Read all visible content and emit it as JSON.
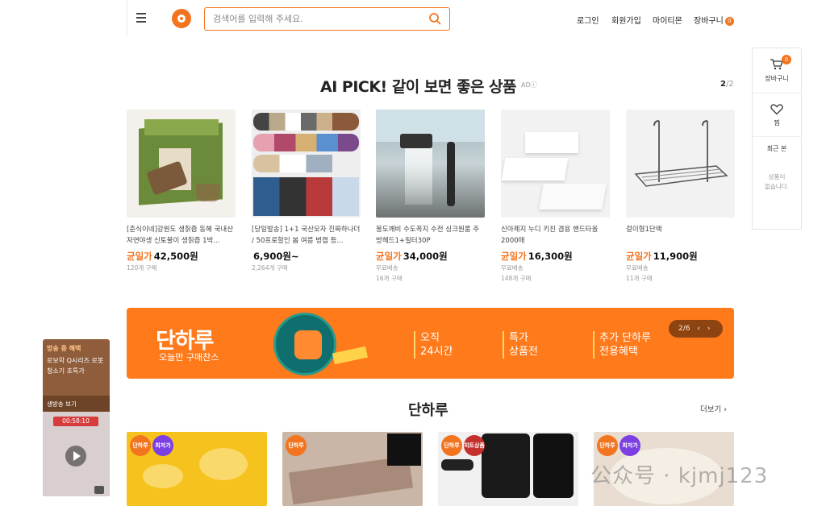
{
  "header": {
    "search_placeholder": "검색어를 입력해 주세요.",
    "nav": {
      "login": "로그인",
      "signup": "회원가입",
      "mytemon": "마이티몬",
      "cart": "장바구니",
      "cart_count": "0"
    }
  },
  "side": {
    "cart_label": "장바구니",
    "cart_count": "0",
    "wish_label": "찜",
    "recent_label": "최근 본",
    "empty_text": "상품이\n없습니다."
  },
  "ai_pick": {
    "title": "AI PICK! 같이 보면 좋은 상품",
    "ad": "ADⓘ",
    "page_current": "2",
    "page_total": "/2",
    "products": [
      {
        "name": "[춘식이네]강원도 생칡즙 동해 국내산 자연야생 신토불이 생칡즙 1박...",
        "price_tag": "균일가",
        "price": "42,500원",
        "shipping": "",
        "sold": "120개 구매"
      },
      {
        "name": "[당일발송] 1+1 국산모자 진짜하나더 / 50프로할인 봄 여름 벙캡 등...",
        "price_tag": "",
        "price": "6,900원~",
        "shipping": "",
        "sold": "2,264개 구매"
      },
      {
        "name": "볼도깨비 수도꼭지 수전 싱크원룸 주방헤드1+필터30P",
        "price_tag": "균일가",
        "price": "34,000원",
        "shipping": "무료배송",
        "sold": "16개 구매"
      },
      {
        "name": "신아제지 누디 키친 겸용 핸드타올 2000매",
        "price_tag": "균일가",
        "price": "16,300원",
        "shipping": "무료배송",
        "sold": "148개 구매"
      },
      {
        "name": "걸이형1단랙",
        "price_tag": "균일가",
        "price": "11,900원",
        "shipping": "무료배송",
        "sold": "11개 구매"
      }
    ]
  },
  "banner": {
    "title": "단하루",
    "subtitle": "오늘만 구매찬스",
    "features": [
      {
        "l1": "오직",
        "l2": "24시간"
      },
      {
        "l1": "특가",
        "l2": "상품전"
      },
      {
        "l1": "추가 단하루",
        "l2": "전용혜택"
      }
    ],
    "pager": "2/6"
  },
  "dahalu": {
    "title": "단하루",
    "more": "더보기",
    "chip": "단하루",
    "chip_purple": "최저가",
    "chip_red": "히트상품"
  },
  "live": {
    "label": "방송 중 혜택",
    "text": "로보락 Q시리즈 로봇청소기 초특가",
    "see": "생방송 보기",
    "timer": "00:58:10"
  },
  "watermark": "公众号 · kjmj123",
  "colors": {
    "accent": "#f3741f",
    "banner": "#ff7a1a"
  }
}
